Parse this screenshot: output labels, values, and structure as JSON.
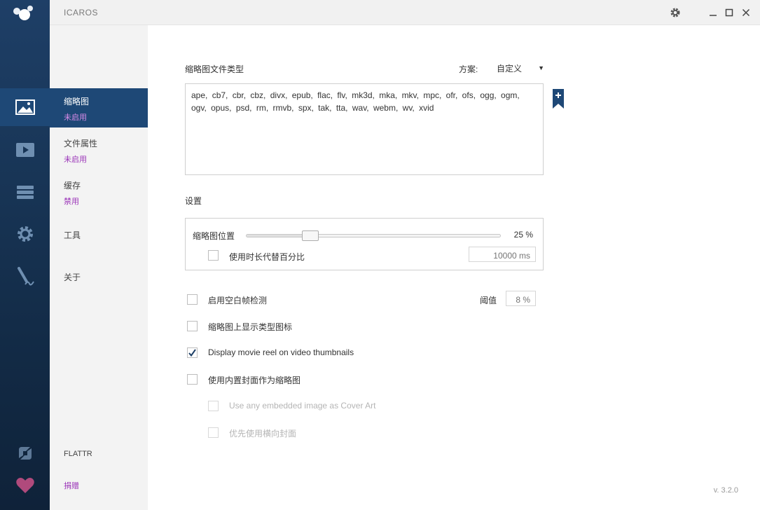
{
  "window": {
    "title": "ICAROS",
    "settings_icon": "gear-icon",
    "minimize_icon": "minimize-icon",
    "maximize_icon": "maximize-icon",
    "close_icon": "close-icon"
  },
  "rail": {
    "items": [
      {
        "icon": "image-icon",
        "active": true
      },
      {
        "icon": "play-icon",
        "active": false
      },
      {
        "icon": "stack-icon",
        "active": false
      },
      {
        "icon": "gear-icon",
        "active": false
      },
      {
        "icon": "pen-icon",
        "active": false
      }
    ],
    "bottom": [
      {
        "icon": "flattr-icon"
      },
      {
        "icon": "heart-icon"
      }
    ]
  },
  "nav": {
    "items": [
      {
        "title": "缩略图",
        "status": "未启用",
        "active": true
      },
      {
        "title": "文件属性",
        "status": "未启用",
        "active": false
      },
      {
        "title": "缓存",
        "status": "禁用",
        "active": false
      },
      {
        "title": "工具",
        "status": "",
        "active": false
      },
      {
        "title": "关于",
        "status": "",
        "active": false
      }
    ],
    "flattr_label": "FLATTR",
    "donate_label": "捐赠"
  },
  "main": {
    "thumbnail_types_label": "缩略图文件类型",
    "scheme_label": "方案:",
    "scheme_value": "自定义",
    "extensions": "ape,  cb7,  cbr,  cbz,  divx,  epub,  flac,  flv,  mk3d,  mka,  mkv,  mpc,  ofr,  ofs,  ogg,  ogm,  ogv,  opus,  psd,  rm,  rmvb,  spx,  tak,  tta,  wav,  webm,  wv,  xvid",
    "settings_label": "设置",
    "thumb_position_label": "缩略图位置",
    "thumb_position_percent": 25,
    "thumb_position_text": "25 %",
    "use_duration_label": "使用时长代替百分比",
    "duration_placeholder": "10000 ms",
    "blank_frame_label": "启用空白帧检测",
    "threshold_label": "阈值",
    "threshold_placeholder": "8 %",
    "show_type_icon_label": "缩略图上显示类型图标",
    "movie_reel_label": "Display movie reel on video thumbnails",
    "movie_reel_checked": true,
    "embedded_cover_label": "使用内置封面作为缩略图",
    "any_embedded_label": "Use any embedded image as Cover Art",
    "prefer_landscape_label": "优先使用横向封面",
    "version": "v. 3.2.0"
  },
  "colors": {
    "rail_bg": "#173455",
    "active_bg": "#1e4876",
    "status_purple": "#9b34b8",
    "heart": "#b04a7c"
  }
}
